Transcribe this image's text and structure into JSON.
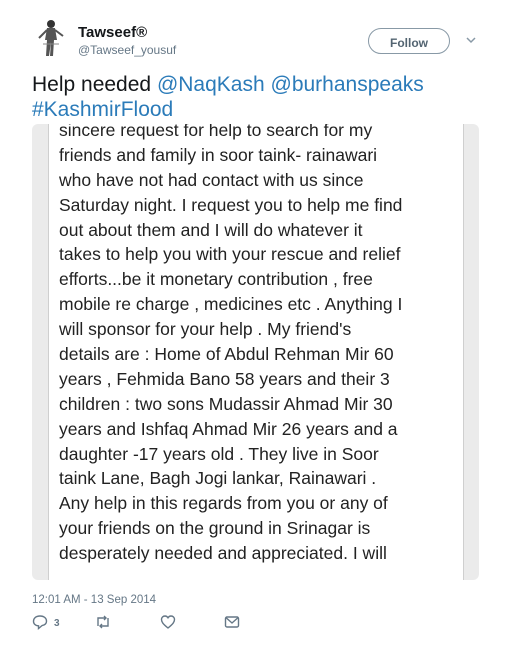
{
  "profile": {
    "name": "Tawseef®",
    "handle": "@Tawseef_yousuf",
    "follow_label": "Follow"
  },
  "tweet": {
    "prefix": "Help needed ",
    "mention1": "@NaqKash",
    "mention2": "@burhanspeaks",
    "hashtag": "#KashmirFlood"
  },
  "image_text": {
    "lines": [
      "sincere request for help to search for my",
      "friends and family in soor taink- rainawari",
      "who have not had contact with  us since",
      "Saturday night. I request you to help me find",
      "out about them and I will do whatever it",
      "takes to help you with your rescue and relief",
      "efforts...be it monetary contribution , free",
      "mobile re charge , medicines etc . Anything I",
      "will sponsor for your help . My friend's",
      "details are : Home of Abdul Rehman Mir 60",
      "years , Fehmida Bano 58 years and their 3",
      "children : two sons Mudassir Ahmad Mir 30",
      "years and Ishfaq Ahmad Mir 26 years and a",
      "daughter -17 years old . They live in Soor",
      "taink Lane, Bagh Jogi lankar, Rainawari .",
      "Any help in this regards from you or any of",
      "your friends on the ground in Srinagar is",
      "desperately needed and appreciated.  I will"
    ]
  },
  "meta": {
    "timestamp": "12:01 AM - 13 Sep 2014",
    "reply_count": "3"
  },
  "icons": {
    "reply": "reply-icon",
    "retweet": "retweet-icon",
    "like": "heart-icon",
    "dm": "envelope-icon",
    "more": "chevron-down-icon"
  }
}
